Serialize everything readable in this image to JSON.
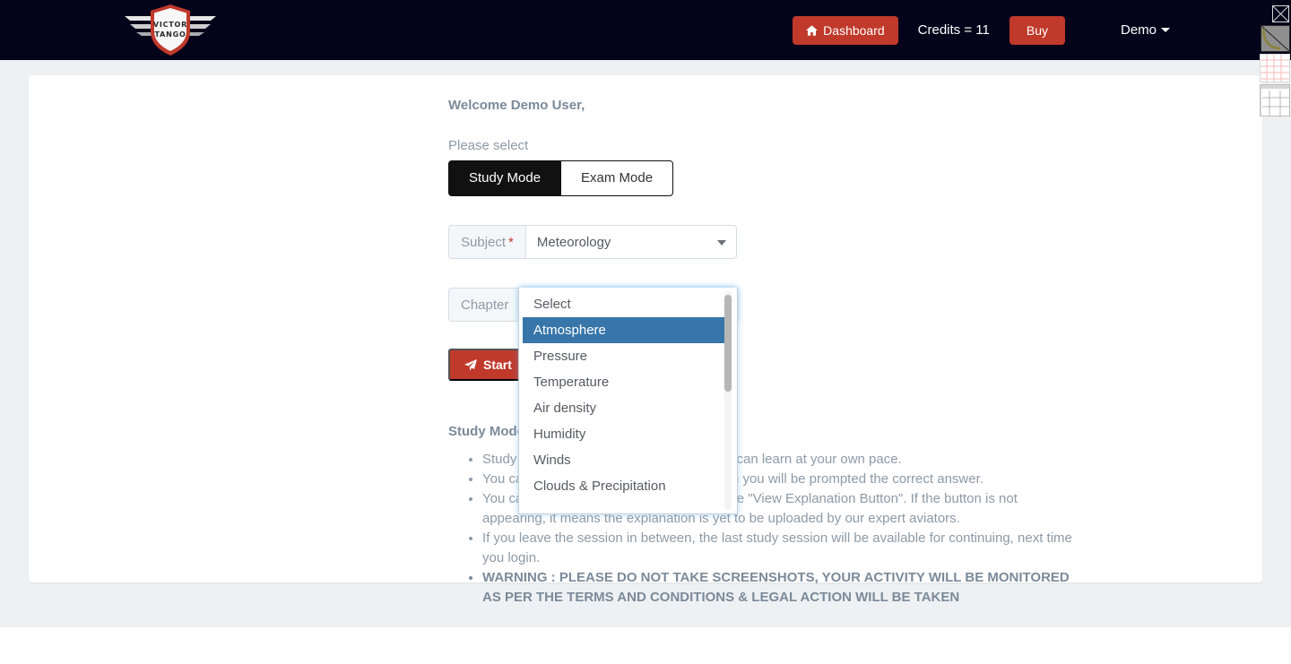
{
  "navbar": {
    "brand_line1": "VICTOR",
    "brand_line2": "TANGO",
    "dashboard_label": "Dashboard",
    "dashboard_icon": "home-icon",
    "credits_label": "Credits = 11",
    "buy_label": "Buy",
    "user_label": "Demo",
    "user_caret_icon": "caret-down-icon",
    "accent_color": "#c0392b",
    "bar_color": "#03041a"
  },
  "main": {
    "welcome": "Welcome Demo User,",
    "please_select_label": "Please select",
    "modes": [
      {
        "label": "Study Mode",
        "active": true
      },
      {
        "label": "Exam Mode",
        "active": false
      }
    ],
    "subject_field": {
      "label": "Subject",
      "required_marker": "*",
      "value": "Meteorology",
      "caret_icon": "caret-down-icon"
    },
    "chapter_field": {
      "label": "Chapter",
      "value": "Atmosphere",
      "caret_icon": "caret-up-icon",
      "open": true
    },
    "start_button": {
      "label": "Start",
      "icon": "paper-plane-icon"
    },
    "instructions": {
      "title": "Study Mode instructions",
      "items": [
        "Study mode is a practice mode where you can learn at your own pace.",
        "You can attempt each question, after which you will be prompted the correct answer.",
        "You can view the explanation by clicking the \"View Explanation Button\". If the button is not appearing, it means the explanation is yet to be uploaded by our expert aviators.",
        "If you leave the session in between, the last study session will be available for continuing, next time you login."
      ],
      "warning": "WARNING : PLEASE DO NOT TAKE SCREENSHOTS, YOUR ACTIVITY WILL BE MONITORED AS PER THE TERMS AND CONDITIONS & LEGAL ACTION WILL BE TAKEN"
    }
  },
  "chapter_dropdown": {
    "options": [
      "Select",
      "Atmosphere",
      "Pressure",
      "Temperature",
      "Air density",
      "Humidity",
      "Winds",
      "Clouds & Precipitation"
    ],
    "selected": "Atmosphere",
    "highlight_color": "#3875a8"
  },
  "edge_widgets": {
    "close_placeholder": "broken-image-close-icon",
    "arc_placeholder": "broken-image-arc-icon",
    "grid_pink_placeholder": "broken-image-grid-pink-icon",
    "grid_gray_placeholder": "broken-image-grid-gray-icon"
  }
}
